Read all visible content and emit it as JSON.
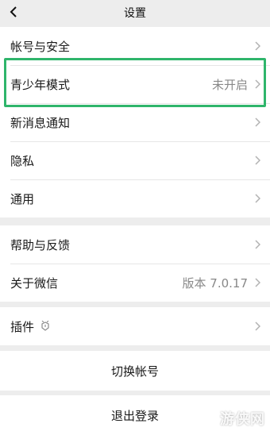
{
  "nav": {
    "title": "设置"
  },
  "groups": {
    "account": {
      "label": "帐号与安全"
    },
    "youth": {
      "label": "青少年模式",
      "value": "未开启"
    },
    "notify": {
      "label": "新消息通知"
    },
    "privacy": {
      "label": "隐私"
    },
    "general": {
      "label": "通用"
    },
    "help": {
      "label": "帮助与反馈"
    },
    "about": {
      "label": "关于微信",
      "value": "版本 7.0.17"
    },
    "plugins": {
      "label": "插件"
    },
    "switch_account": {
      "label": "切换帐号"
    },
    "logout": {
      "label": "退出登录"
    }
  },
  "watermark": {
    "text": "游侠网"
  },
  "colors": {
    "highlight": "#2fb56b",
    "background": "#ededed",
    "chevron": "#b2b2b2"
  }
}
